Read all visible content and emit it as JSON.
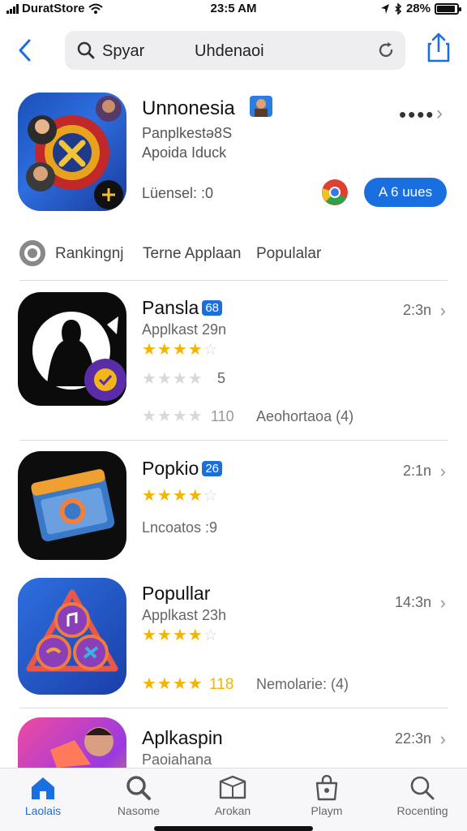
{
  "status": {
    "carrier": "DuratStore",
    "time": "23:5 AM",
    "battery": "28%"
  },
  "nav": {
    "search_label": "Spyar",
    "search_query": "Uhdenaoi"
  },
  "featured": {
    "title": "Unnonesia",
    "line1": "Panplkestǝ8S",
    "line2": "Apoida Iduck",
    "meta": "Lüensel: :0",
    "more": "••••",
    "get_label": "A 6 uues"
  },
  "ranking": {
    "items": [
      "Rankingnj",
      "Terne Applaan",
      "Populalar"
    ]
  },
  "apps": [
    {
      "name": "Pansla",
      "badge": "68",
      "sub": "Applkast 29n",
      "stars": 4,
      "time": "2:3n",
      "extra_rating": "5",
      "stars2_label": "110",
      "extra_text": "Aeohortaoa (4)"
    },
    {
      "name": "Popkio",
      "badge": "26",
      "stars": 4,
      "time": "2:1n",
      "sub2": "Lncoatos :9"
    },
    {
      "name": "Popullar",
      "sub": "Applkast 23h",
      "stars": 4,
      "time": "14:3n",
      "stars2_label": "118",
      "extra_text": "Nemolarie: (4)"
    },
    {
      "name": "Aplkaspin",
      "sub": "Paoiahana",
      "time": "22:3n"
    }
  ],
  "tabs": [
    {
      "label": "Laolais",
      "icon": "home-icon",
      "active": true
    },
    {
      "label": "Nasome",
      "icon": "search-icon"
    },
    {
      "label": "Arokan",
      "icon": "box-icon"
    },
    {
      "label": "Playm",
      "icon": "bag-icon"
    },
    {
      "label": "Rocenting",
      "icon": "search-icon"
    }
  ],
  "colors": {
    "accent": "#1a6fe0",
    "star": "#f5b400"
  }
}
